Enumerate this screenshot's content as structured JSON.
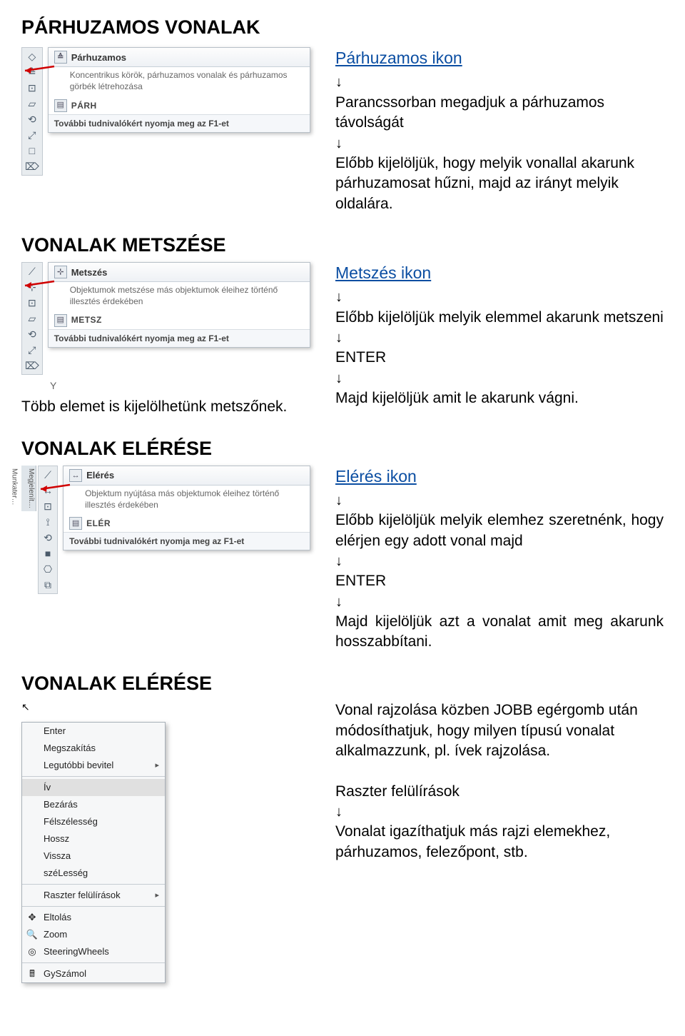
{
  "headings": {
    "h1": "PÁRHUZAMOS VONALAK",
    "h2": "VONALAK METSZÉSE",
    "h3": "VONALAK ELÉRÉSE",
    "h4": "VONALAK ELÉRÉSE"
  },
  "notes": {
    "metszes_left_note": "Több elemet is kijelölhetünk metszőnek."
  },
  "parhuzamos": {
    "link": "Párhuzamos ikon",
    "p1": "Parancssorban megadjuk a párhuzamos távolságát",
    "p2": "Előbb kijelöljük, hogy melyik vonallal akarunk párhuzamosat hűzni, majd az irányt melyik oldalára."
  },
  "metszes": {
    "link": "Metszés ikon",
    "p1": "Előbb kijelöljük melyik elemmel akarunk metszeni",
    "enter": "ENTER",
    "p2": "Majd kijelöljük amit le akarunk vágni."
  },
  "eleres": {
    "link": "Elérés ikon",
    "p1": "Előbb kijelöljük melyik elemhez szeretnénk, hogy elérjen egy adott vonal majd",
    "enter": "ENTER",
    "p2": "Majd kijelöljük azt a vonalat amit meg akarunk hosszabbítani."
  },
  "eleres2": {
    "p1": "Vonal rajzolása közben JOBB egérgomb után módosíthatjuk, hogy milyen típusú vonalat alkalmazzunk, pl. ívek rajzolása.",
    "p2": "Raszter felülírások",
    "p3": "Vonalat igazíthatjuk más rajzi elemekhez, párhuzamos, felezőpont, stb."
  },
  "tooltip_parh": {
    "title": "Párhuzamos",
    "desc": "Koncentrikus körök, párhuzamos vonalak és párhuzamos görbék létrehozása",
    "cmd": "PÁRH",
    "f1": "További tudnivalókért nyomja meg az F1-et"
  },
  "tooltip_metsz": {
    "title": "Metszés",
    "desc": "Objektumok metszése más objektumok éleihez történő illesztés érdekében",
    "cmd": "METSZ",
    "f1": "További tudnivalókért nyomja meg az F1-et"
  },
  "tooltip_eler": {
    "title": "Elérés",
    "desc": "Objektum nyújtása más objektumok éleihez történő illesztés érdekében",
    "cmd": "ELÉR",
    "f1": "További tudnivalókért nyomja meg az F1-et"
  },
  "sidebar_tabs": {
    "t1": "Megjelenít…",
    "t2": "Munkater…"
  },
  "context_menu": {
    "m1": "Enter",
    "m2": "Megszakítás",
    "m3": "Legutóbbi bevitel",
    "m4": "Ív",
    "m5": "Bezárás",
    "m6": "Félszélesség",
    "m7": "Hossz",
    "m8": "Vissza",
    "m9": "széLesség",
    "m10": "Raszter felülírások",
    "m11": "Eltolás",
    "m12": "Zoom",
    "m13": "SteeringWheels",
    "m14": "GySzámol"
  },
  "arrow": "↓"
}
